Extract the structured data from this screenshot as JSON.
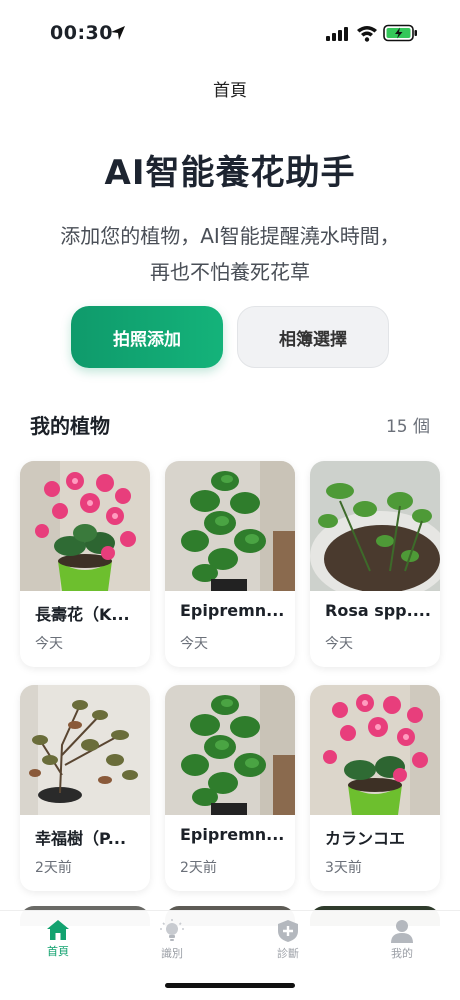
{
  "status_bar": {
    "time": "00:30"
  },
  "nav": {
    "title": "首頁"
  },
  "hero": {
    "title": "AI智能養花助手",
    "subtitle_line1": "添加您的植物，AI智能提醒澆水時間，",
    "subtitle_line2": "再也不怕養死花草"
  },
  "actions": {
    "primary_label": "拍照添加",
    "secondary_label": "相簿選擇"
  },
  "plants_section": {
    "title": "我的植物",
    "count": "15 個",
    "plants": [
      {
        "name": "長壽花（K...",
        "date": "今天",
        "image": "kalanchoe-photo"
      },
      {
        "name": "Epipremn...",
        "date": "今天",
        "image": "pothos-photo"
      },
      {
        "name": "Rosa spp....",
        "date": "今天",
        "image": "rose-photo"
      },
      {
        "name": "幸福樹（P...",
        "date": "2天前",
        "image": "happiness-tree-photo"
      },
      {
        "name": "Epipremn...",
        "date": "2天前",
        "image": "pothos-photo"
      },
      {
        "name": "カランコエ",
        "date": "3天前",
        "image": "kalanchoe-photo"
      }
    ]
  },
  "tabbar": {
    "tabs": [
      {
        "label": "首頁",
        "icon": "home-icon",
        "active": true
      },
      {
        "label": "識別",
        "icon": "lightbulb-icon",
        "active": false
      },
      {
        "label": "診斷",
        "icon": "shield-plus-icon",
        "active": false
      },
      {
        "label": "我的",
        "icon": "person-icon",
        "active": false
      }
    ]
  },
  "colors": {
    "accent": "#12a26f",
    "primary_button": "#0f9a6b",
    "text": "#1c2128"
  }
}
